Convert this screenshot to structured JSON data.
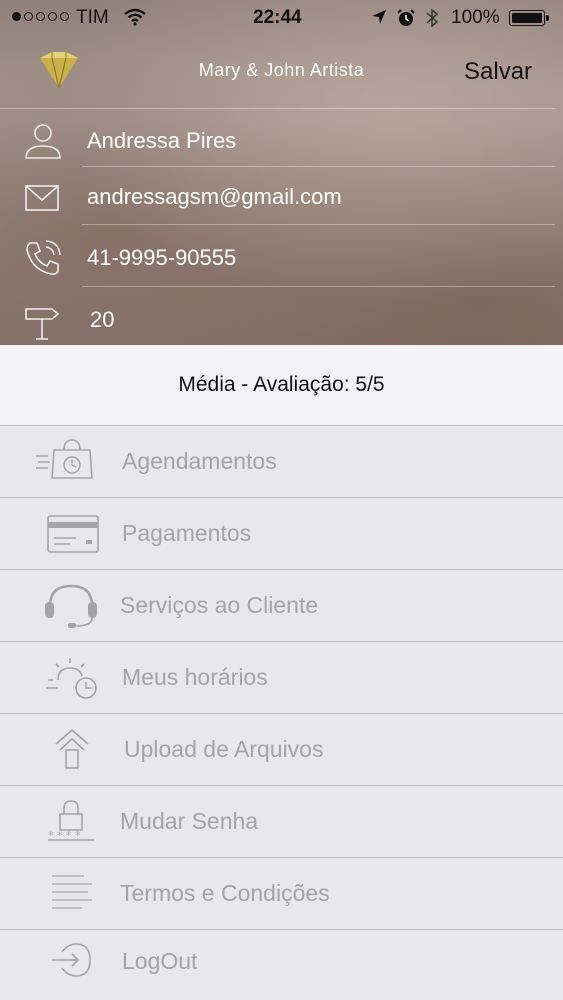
{
  "status_bar": {
    "carrier": "TIM",
    "time": "22:44",
    "battery": "100%",
    "signal_bars": 1,
    "signal_total": 5
  },
  "header": {
    "title": "Mary & John Artista",
    "save_label": "Salvar",
    "logo_icon": "diamond-icon",
    "colors": {
      "logo_gold": "#c9b24a",
      "text_on_photo": "#ffffff"
    }
  },
  "profile": {
    "name": "Andressa Pires",
    "email": "andressagsm@gmail.com",
    "phone": "41-9995-90555",
    "number": "20"
  },
  "rating": {
    "text": "Média - Avaliação: 5/5"
  },
  "menu": {
    "items": [
      {
        "label": "Agendamentos",
        "icon": "shopping-bag-clock-icon"
      },
      {
        "label": "Pagamentos",
        "icon": "credit-card-icon"
      },
      {
        "label": "Serviços ao Cliente",
        "icon": "headset-icon"
      },
      {
        "label": "Meus horários",
        "icon": "sun-clock-icon"
      },
      {
        "label": "Upload de Arquivos",
        "icon": "upload-arrow-icon"
      },
      {
        "label": "Mudar Senha",
        "icon": "lock-icon"
      },
      {
        "label": "Termos e Condições",
        "icon": "text-lines-icon"
      },
      {
        "label": "LogOut",
        "icon": "logout-icon"
      }
    ],
    "colors": {
      "label": "#a4a4a7",
      "divider": "#bdbcbf",
      "background": "#e8e7ea"
    }
  }
}
